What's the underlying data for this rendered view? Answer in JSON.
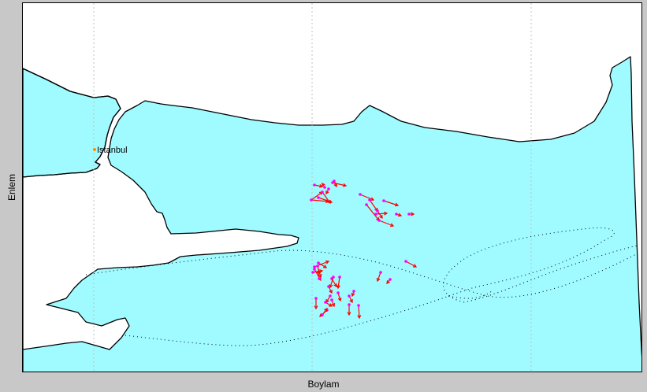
{
  "figure": {
    "xlabel": "Boylam",
    "ylabel": "Enlem"
  },
  "colors": {
    "sea": "#9ffbff",
    "land": "#ffffff",
    "coastline": "#000000",
    "grid": "#c0c0c0",
    "arrow": "#ff0000",
    "arrow_tip": "#ff00ff",
    "city_marker": "#ff8c00"
  },
  "map": {
    "city": {
      "name": "Istanbul",
      "marker_icon": "orange-dot"
    },
    "gridlines": {
      "vertical": true,
      "style": "dotted"
    },
    "velocity_vectors": {
      "count": 52,
      "color_name": "red arrows with magenta endpoints"
    },
    "tracks": {
      "style": "dotted black lines"
    }
  }
}
